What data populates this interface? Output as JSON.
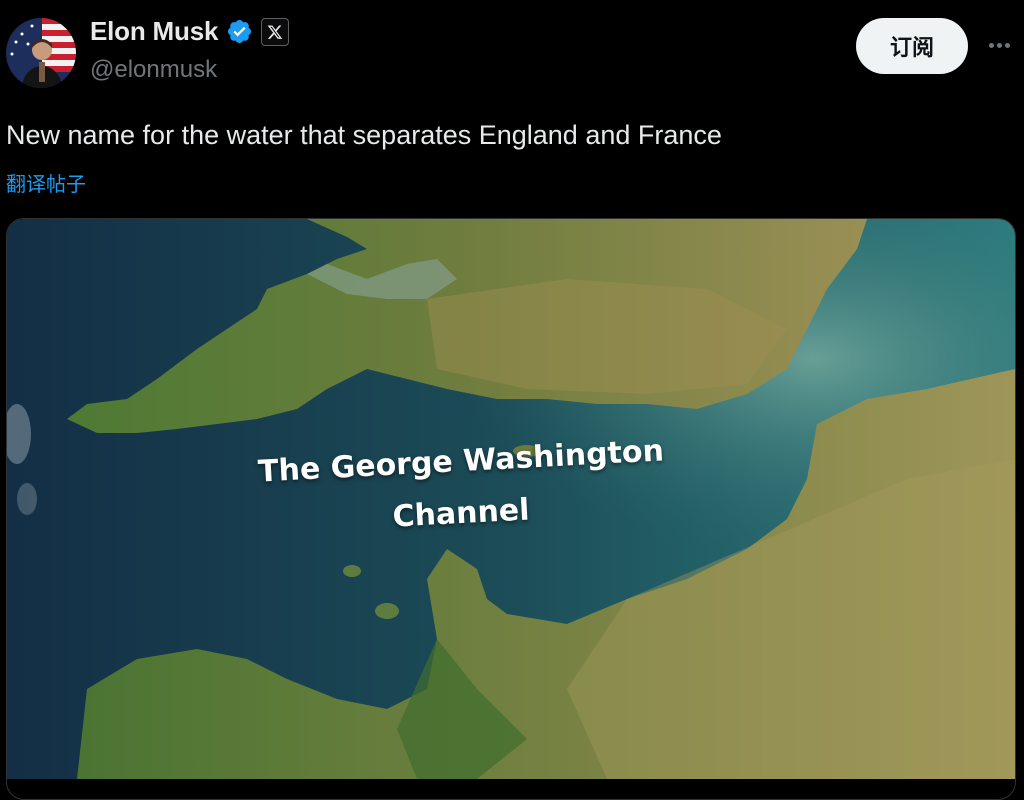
{
  "author": {
    "display_name": "Elon Musk",
    "handle": "@elonmusk",
    "verified_icon": "verified-badge-icon",
    "affiliation_icon": "x-logo-icon"
  },
  "actions": {
    "subscribe_label": "订阅",
    "more_icon": "more-options-icon"
  },
  "tweet": {
    "text": "New name for the water that separates England and France",
    "translate_label": "翻译帖子"
  },
  "media": {
    "type": "satellite map image",
    "label_line1": "The George Washington",
    "label_line2": "Channel"
  },
  "colors": {
    "background": "#000000",
    "text": "#e7e9ea",
    "secondary_text": "#71767b",
    "link": "#1d9bf0",
    "verified": "#1d9bf0",
    "subscribe_bg": "#eff3f4"
  }
}
